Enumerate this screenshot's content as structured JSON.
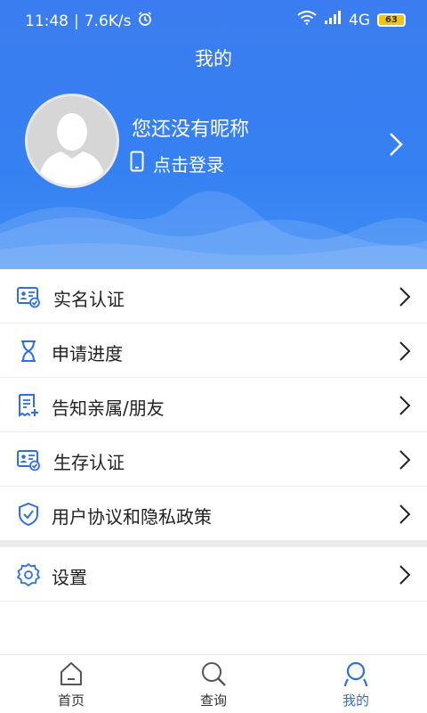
{
  "status_bar": {
    "time": "11:48",
    "speed": "7.6K/s",
    "network": "4G",
    "battery": "63"
  },
  "header": {
    "title": "我的",
    "nickname": "您还没有昵称",
    "login_text": "点击登录"
  },
  "menu": [
    {
      "label": "实名认证",
      "icon": "id-card-check-icon"
    },
    {
      "label": "申请进度",
      "icon": "hourglass-icon"
    },
    {
      "label": "告知亲属/朋友",
      "icon": "document-add-icon"
    },
    {
      "label": "生存认证",
      "icon": "id-card-check-icon"
    },
    {
      "label": "用户协议和隐私政策",
      "icon": "shield-check-icon"
    },
    {
      "label": "设置",
      "icon": "gear-icon"
    }
  ],
  "bottom_nav": [
    {
      "label": "首页",
      "icon": "home-icon",
      "active": false
    },
    {
      "label": "查询",
      "icon": "search-icon",
      "active": false
    },
    {
      "label": "我的",
      "icon": "user-icon",
      "active": true
    }
  ],
  "colors": {
    "primary": "#3580f2",
    "icon": "#2f6fe0",
    "active_tab": "#2f6fe0"
  }
}
